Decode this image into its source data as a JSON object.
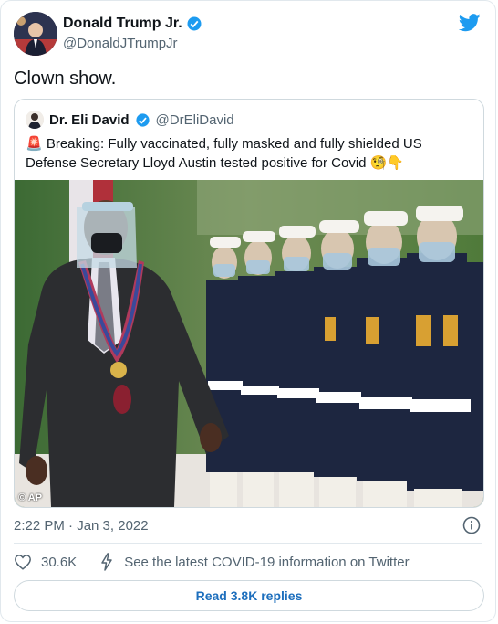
{
  "author": {
    "name": "Donald Trump Jr.",
    "handle": "@DonaldJTrumpJr",
    "verified": true
  },
  "tweet": {
    "text": "Clown show."
  },
  "quoted_tweet": {
    "name": "Dr. Eli David",
    "handle": "@DrEliDavid",
    "verified": true,
    "text": "🚨 Breaking: Fully vaccinated, fully masked and fully shielded US Defense Secretary Lloyd Austin tested positive for Covid 🧐👇",
    "photo_credit": "© AP"
  },
  "meta": {
    "timestamp": "2:22 PM · Jan 3, 2022"
  },
  "actions": {
    "like_count": "30.6K",
    "covid_info": "See the latest COVID-19 information on Twitter",
    "read_replies": "Read 3.8K replies"
  },
  "colors": {
    "twitter_blue": "#1d9bf0",
    "link_blue": "#1d6fbd",
    "text": "#0f1419",
    "secondary": "#536471"
  }
}
